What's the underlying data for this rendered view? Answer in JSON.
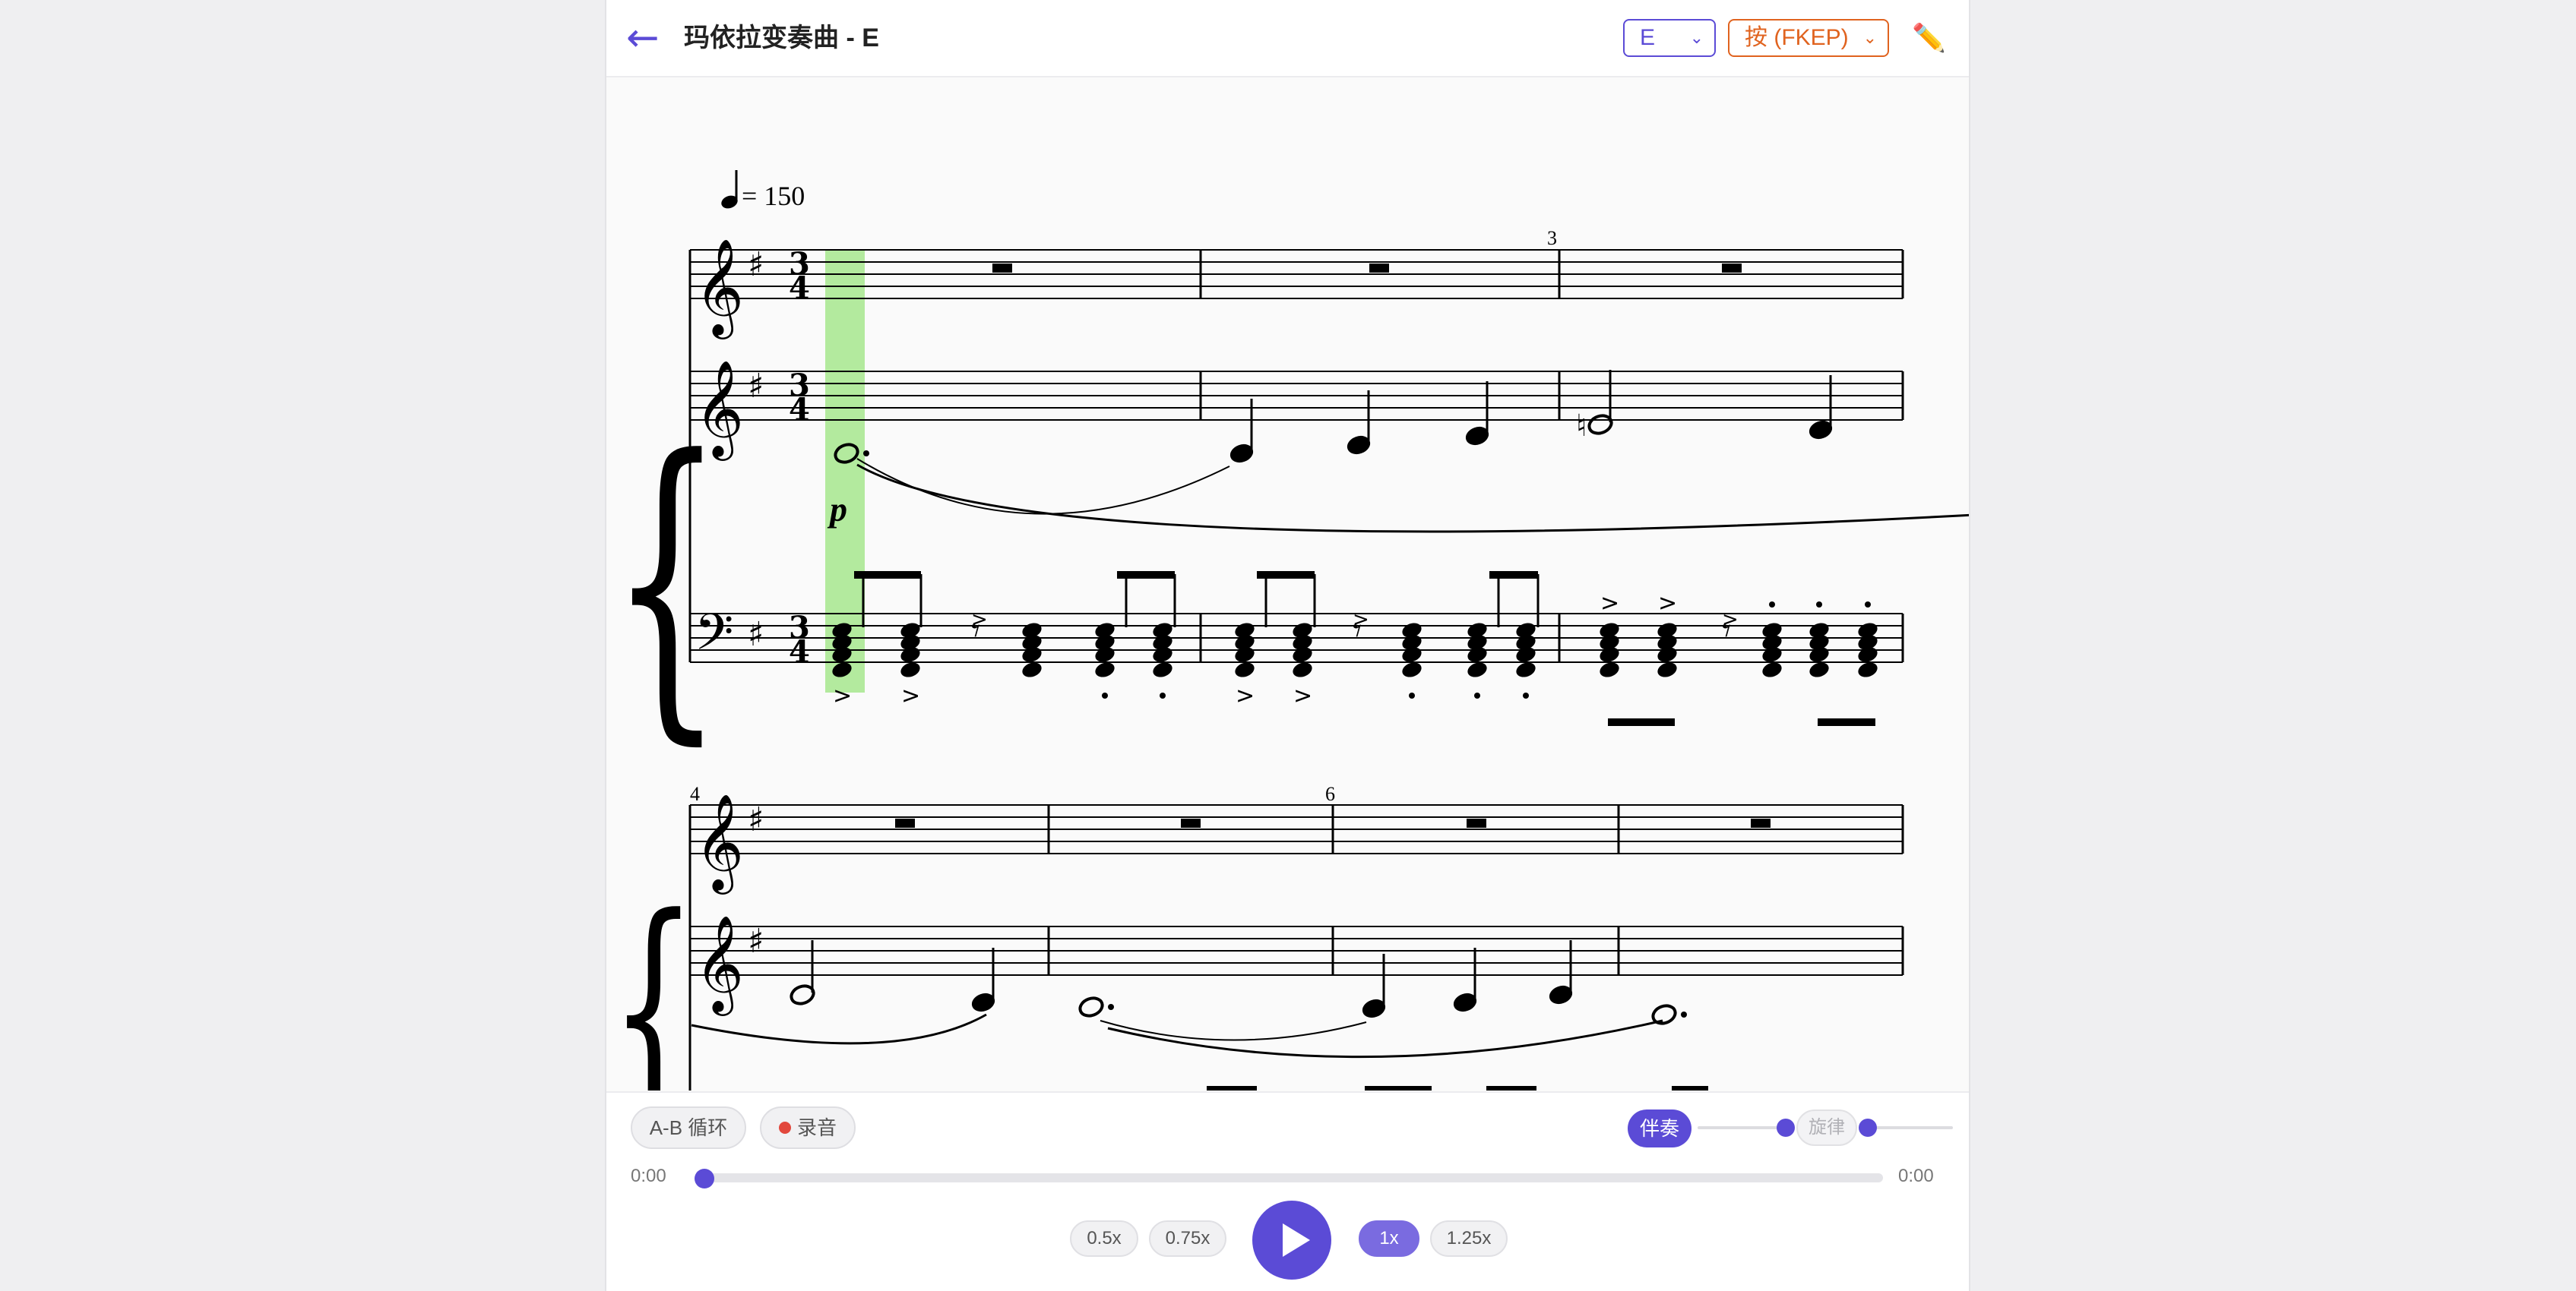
{
  "header": {
    "back_icon": "←",
    "title": "玛依拉变奏曲 - E",
    "key_select": "E",
    "mode_select": "按 (FKEP)",
    "edit_icon": "✏️"
  },
  "score": {
    "tempo": "= 150",
    "time_numerator": "3",
    "time_denominator": "4",
    "dynamic": "p",
    "measure_numbers": [
      "3",
      "4",
      "6"
    ]
  },
  "controls": {
    "ab_loop_label": "A-B 循环",
    "record_label": "录音",
    "accompaniment_label": "伴奏",
    "melody_label": "旋律",
    "current_time": "0:00",
    "duration": "0:00",
    "progress": 0,
    "accompaniment_volume": 1,
    "melody_volume": 0,
    "speeds": [
      "0.5x",
      "0.75x",
      "1x",
      "1.25x"
    ],
    "active_speed": "1x"
  },
  "colors": {
    "accent": "#5b4bd6",
    "mode_orange": "#e0631f",
    "record_red": "#e2483d",
    "playhead_green": "#a6e68d"
  }
}
